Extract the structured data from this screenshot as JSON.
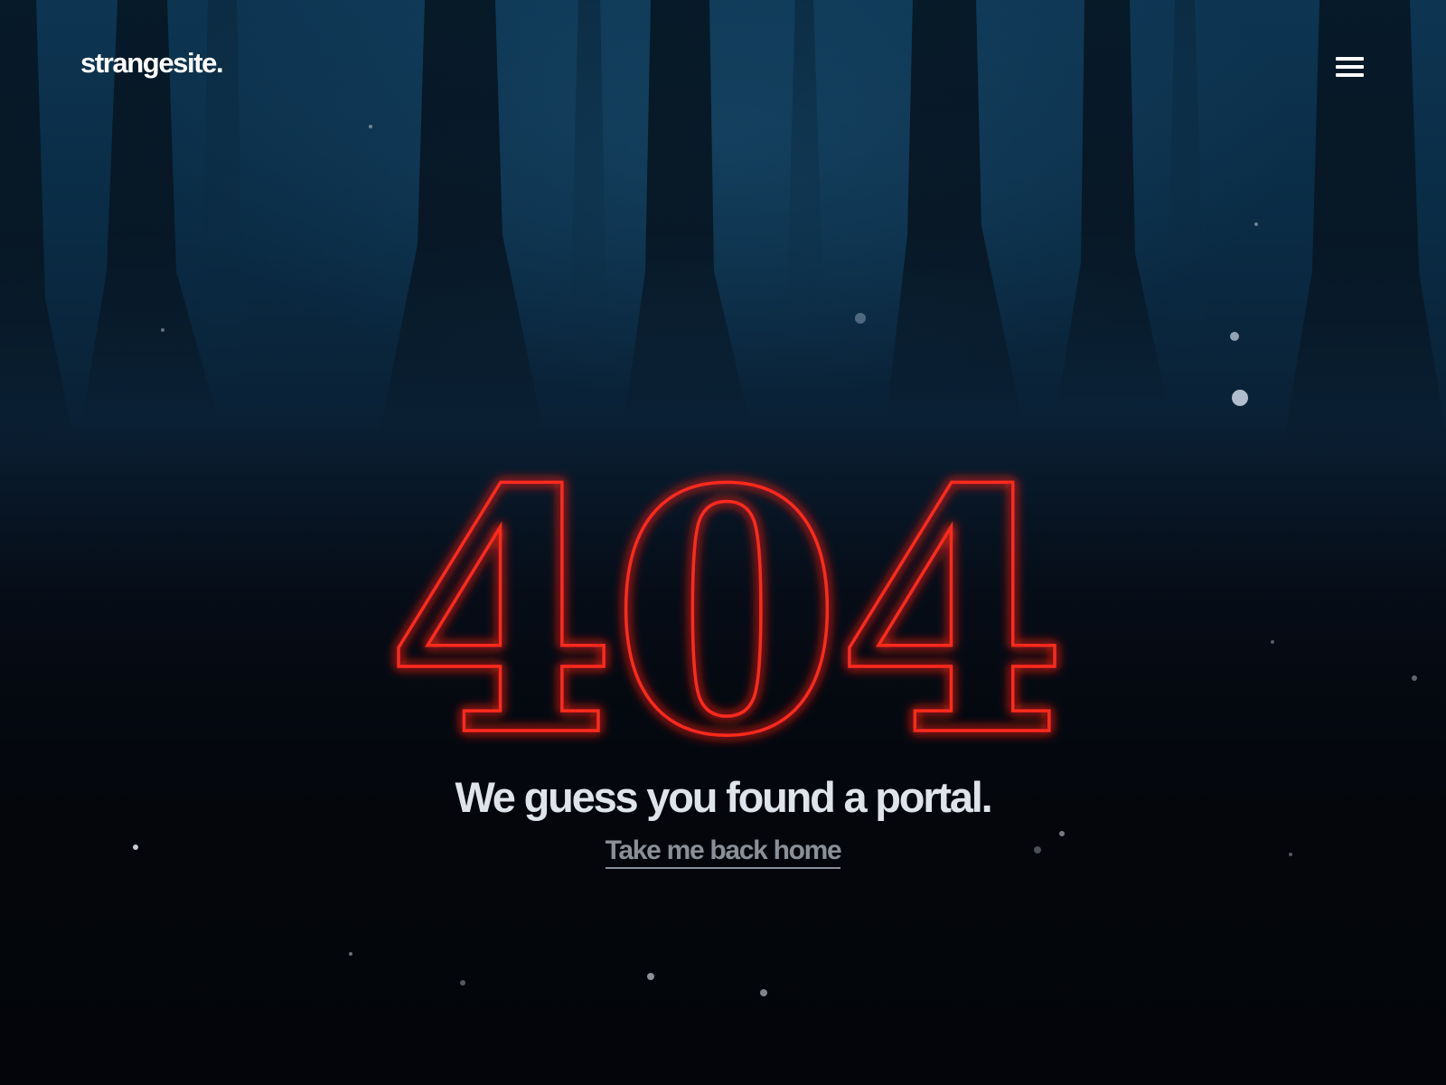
{
  "header": {
    "logo_text": "strangesite.",
    "menu_icon": "hamburger-menu-icon"
  },
  "hero": {
    "error_code": "404",
    "headline": "We guess you found a portal.",
    "home_link_label": "Take me back home"
  },
  "colors": {
    "neon_red": "#ff2a1a",
    "background_top": "#0d3552",
    "background_bottom": "#03050a",
    "headline": "#dfe3ea",
    "link": "#8b8f97"
  }
}
